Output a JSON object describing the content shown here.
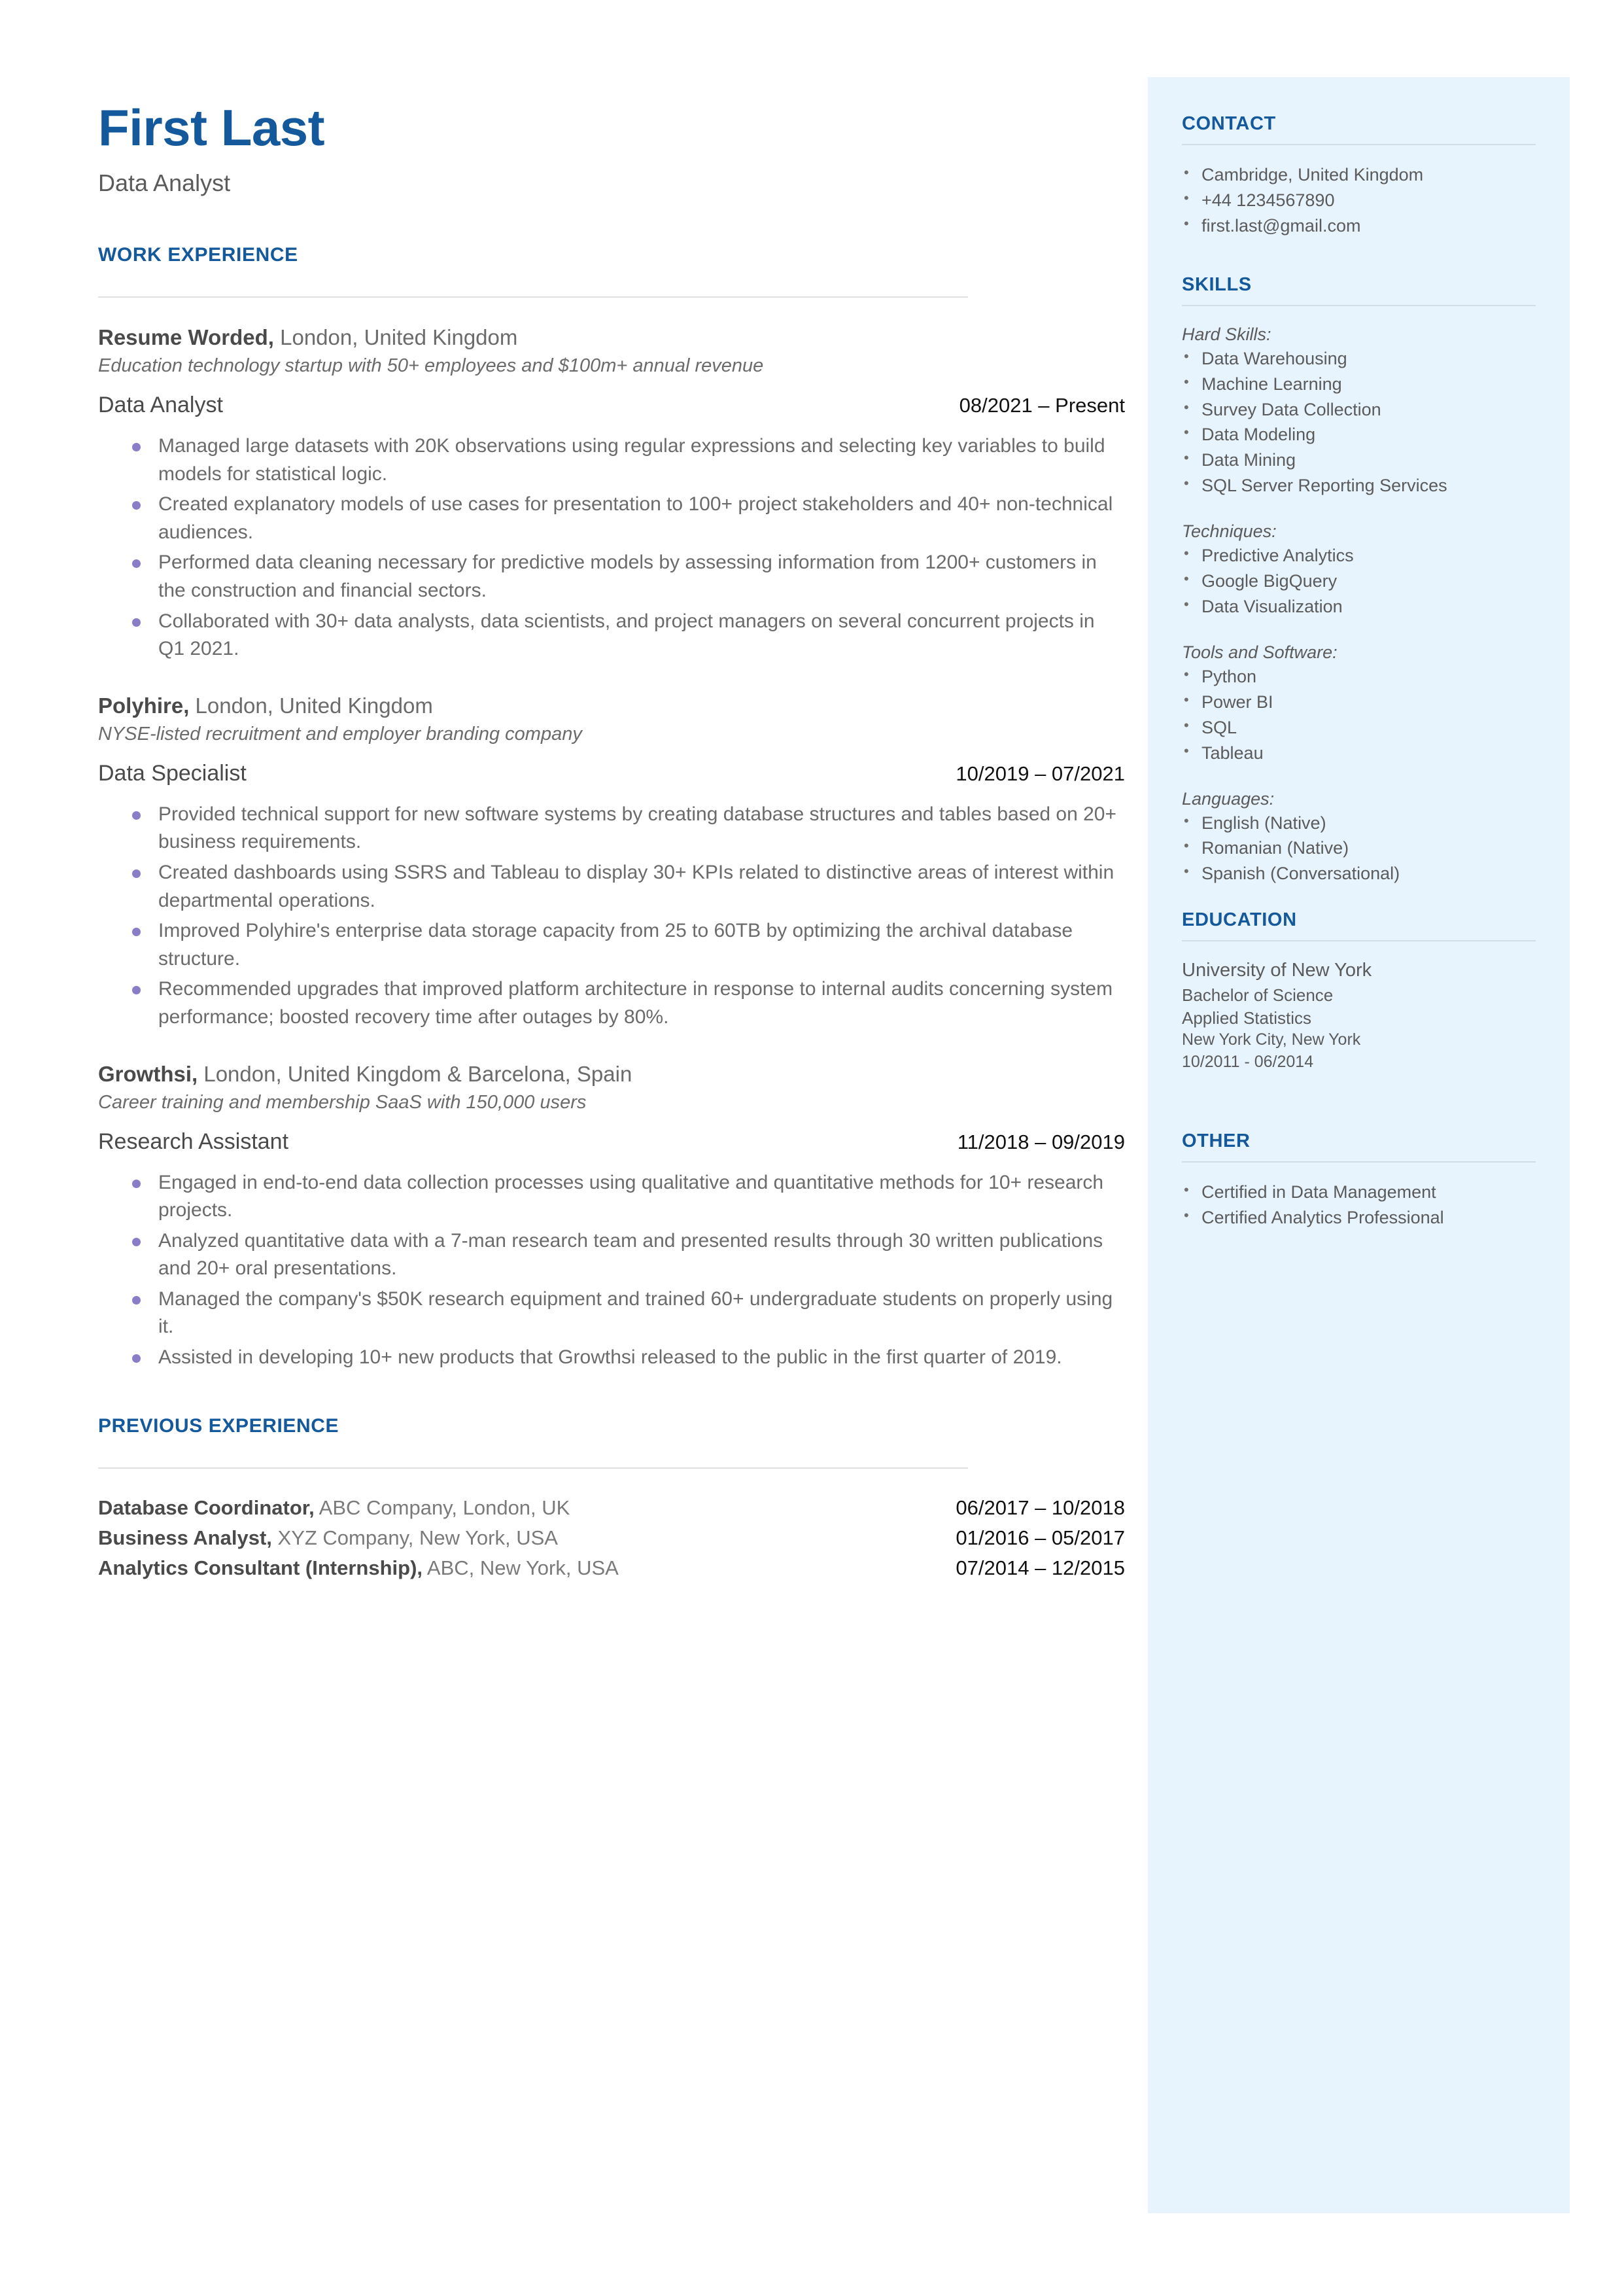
{
  "header": {
    "name": "First Last",
    "role": "Data Analyst"
  },
  "main": {
    "work_experience_heading": "WORK EXPERIENCE",
    "previous_experience_heading": "PREVIOUS EXPERIENCE",
    "jobs": [
      {
        "company": "Resume Worded,",
        "location": " London, United Kingdom",
        "description": "Education technology startup with 50+ employees and $100m+ annual revenue",
        "title": "Data Analyst",
        "dates": "08/2021 – Present",
        "bullets": [
          "Managed large datasets with 20K observations using regular expressions and selecting key variables to build models for statistical logic.",
          "Created explanatory models of use cases for presentation to 100+ project stakeholders and  40+ non-technical audiences.",
          "Performed data cleaning necessary for predictive models by assessing information from 1200+ customers in the construction and financial sectors.",
          "Collaborated with 30+ data analysts, data scientists, and project managers on several concurrent projects in Q1 2021."
        ]
      },
      {
        "company": "Polyhire,",
        "location": " London, United Kingdom",
        "description": "NYSE-listed recruitment and employer branding company",
        "title": "Data Specialist",
        "dates": "10/2019 – 07/2021",
        "bullets": [
          "Provided technical support for new software systems by creating database structures and tables based on 20+ business requirements.",
          "Created dashboards using SSRS and Tableau to display 30+ KPIs related to distinctive areas of interest within departmental operations.",
          "Improved Polyhire's enterprise data storage capacity from 25 to 60TB by optimizing the archival database structure.",
          "Recommended upgrades that improved platform architecture in response to internal audits concerning system performance; boosted recovery time after outages by 80%."
        ]
      },
      {
        "company": "Growthsi,",
        "location": " London, United Kingdom & Barcelona, Spain",
        "description": "Career training and membership SaaS with 150,000 users",
        "title": "Research Assistant",
        "dates": "11/2018 – 09/2019",
        "bullets": [
          "Engaged in end-to-end data collection processes using qualitative and quantitative methods for 10+ research projects.",
          "Analyzed quantitative data with a 7-man research team and presented results through 30 written publications and 20+ oral presentations.",
          "Managed the company's $50K research equipment and trained 60+ undergraduate students on properly using it.",
          "Assisted in developing 10+ new products that Growthsi released to the public in the first quarter of 2019."
        ]
      }
    ],
    "previous_experience": [
      {
        "title": "Database Coordinator,",
        "detail": " ABC Company, London, UK",
        "dates": "06/2017 – 10/2018"
      },
      {
        "title": "Business Analyst,",
        "detail": " XYZ Company, New York, USA",
        "dates": "01/2016 – 05/2017"
      },
      {
        "title": "Analytics Consultant (Internship),",
        "detail": " ABC, New York, USA",
        "dates": "07/2014 – 12/2015"
      }
    ]
  },
  "sidebar": {
    "contact": {
      "heading": "CONTACT",
      "items": [
        " Cambridge, United Kingdom",
        "+44 1234567890",
        "first.last@gmail.com"
      ]
    },
    "skills": {
      "heading": "SKILLS",
      "groups": [
        {
          "label": "Hard Skills:",
          "items": [
            "Data Warehousing",
            "Machine Learning",
            "Survey Data Collection",
            "Data Modeling",
            "Data Mining",
            "SQL Server Reporting Services"
          ]
        },
        {
          "label": "Techniques:",
          "items": [
            "Predictive Analytics",
            "Google BigQuery",
            "Data Visualization"
          ]
        },
        {
          "label": "Tools and Software:",
          "items": [
            "Python",
            "Power BI",
            "SQL",
            "Tableau"
          ]
        },
        {
          "label": "Languages:",
          "items": [
            "English (Native)",
            "Romanian (Native)",
            "Spanish (Conversational)"
          ]
        }
      ]
    },
    "education": {
      "heading": "EDUCATION",
      "school": "University of New York",
      "degree": "Bachelor of Science",
      "field": "Applied Statistics",
      "location": "New York City, New York",
      "dates": "10/2011 - 06/2014"
    },
    "other": {
      "heading": "OTHER",
      "items": [
        "Certified in Data Management",
        "Certified Analytics Professional"
      ]
    }
  },
  "colors": {
    "accent_blue": "#14599b",
    "sidebar_bg": "#e7f3fd",
    "bullet_purple": "#8b7cc8",
    "body_gray": "#6b6b6b"
  }
}
